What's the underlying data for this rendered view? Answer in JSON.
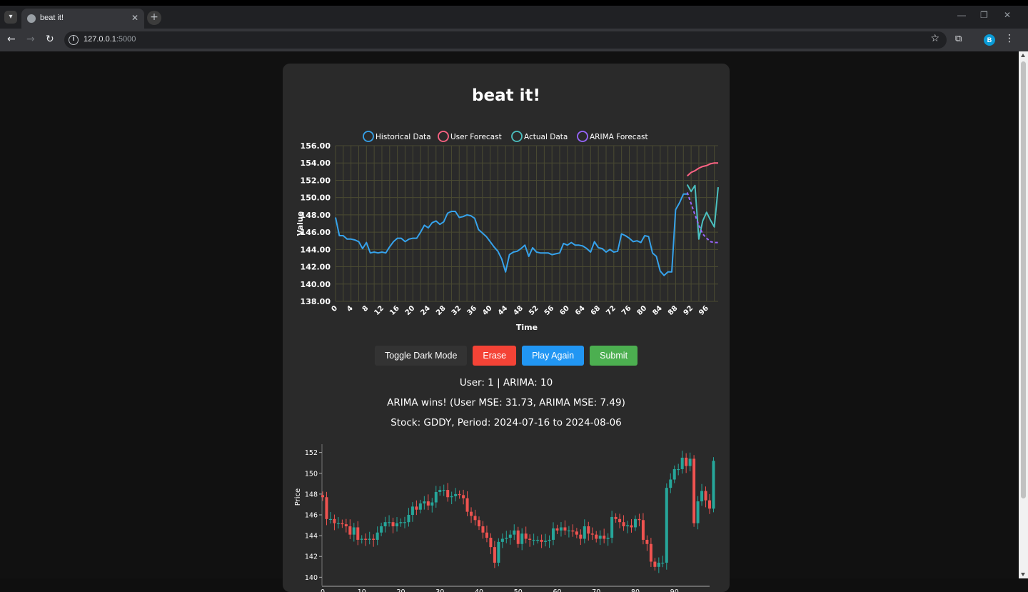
{
  "browser": {
    "tab_title": "beat it!",
    "url_host": "127.0.0.1",
    "url_port": ":5000",
    "avatar_letter": "B"
  },
  "page": {
    "title": "beat it!",
    "buttons": {
      "toggle_dark": "Toggle Dark Mode",
      "erase": "Erase",
      "play_again": "Play Again",
      "submit": "Submit"
    },
    "score_text": "User: 1 | ARIMA: 10",
    "result_text": "ARIMA wins! (User MSE: 31.73, ARIMA MSE: 7.49)",
    "stock_text": "Stock: GDDY, Period: 2024-07-16 to 2024-08-06"
  },
  "colors": {
    "historical": "#36a2eb",
    "user_forecast": "#ff6384",
    "actual": "#4bc0c0",
    "arima": "#9966ff",
    "candle_up": "#26a69a",
    "candle_down": "#ef5350",
    "erase_button": "#f44336",
    "play_button": "#2196f3",
    "submit_button": "#4caf50"
  },
  "chart_data": [
    {
      "type": "line",
      "title": "",
      "xlabel": "Time",
      "ylabel": "Value",
      "xlim": [
        0,
        99
      ],
      "ylim": [
        138,
        156
      ],
      "y_ticks": [
        "138.00",
        "140.00",
        "142.00",
        "144.00",
        "146.00",
        "148.00",
        "150.00",
        "152.00",
        "154.00",
        "156.00"
      ],
      "x_ticks": [
        "0",
        "4",
        "8",
        "12",
        "16",
        "20",
        "24",
        "28",
        "32",
        "36",
        "40",
        "44",
        "48",
        "52",
        "56",
        "60",
        "64",
        "68",
        "72",
        "76",
        "80",
        "84",
        "88",
        "92",
        "96"
      ],
      "grid": true,
      "legend_position": "top",
      "series": [
        {
          "name": "Historical Data",
          "x": [
            0,
            1,
            2,
            3,
            4,
            5,
            6,
            7,
            8,
            9,
            10,
            11,
            12,
            13,
            14,
            15,
            16,
            17,
            18,
            19,
            20,
            21,
            22,
            23,
            24,
            25,
            26,
            27,
            28,
            29,
            30,
            31,
            32,
            33,
            34,
            35,
            36,
            37,
            38,
            39,
            40,
            41,
            42,
            43,
            44,
            45,
            46,
            47,
            48,
            49,
            50,
            51,
            52,
            53,
            54,
            55,
            56,
            57,
            58,
            59,
            60,
            61,
            62,
            63,
            64,
            65,
            66,
            67,
            68,
            69,
            70,
            71,
            72,
            73,
            74,
            75,
            76,
            77,
            78,
            79,
            80,
            81,
            82,
            83,
            84,
            85,
            86,
            87,
            88,
            89,
            90,
            91
          ],
          "values": [
            147.7,
            145.6,
            145.6,
            145.2,
            145.2,
            145.1,
            144.9,
            144.1,
            144.8,
            143.6,
            143.7,
            143.6,
            143.7,
            143.6,
            144.3,
            144.9,
            145.3,
            145.3,
            144.9,
            145.2,
            145.3,
            145.3,
            146.0,
            146.8,
            146.5,
            147.1,
            147.3,
            146.9,
            147.2,
            148.2,
            148.4,
            148.4,
            147.7,
            147.8,
            148.0,
            147.9,
            147.6,
            146.3,
            145.9,
            145.5,
            144.9,
            144.3,
            143.8,
            142.9,
            141.4,
            143.4,
            143.7,
            143.8,
            144.1,
            144.5,
            143.2,
            144.2,
            143.7,
            143.6,
            143.6,
            143.6,
            143.4,
            143.5,
            143.6,
            144.7,
            144.5,
            144.8,
            144.5,
            144.5,
            144.4,
            144.1,
            143.7,
            144.9,
            144.2,
            144.1,
            143.7,
            144.0,
            143.7,
            143.8,
            145.8,
            145.6,
            145.3,
            144.9,
            145.0,
            144.8,
            145.6,
            145.5,
            143.6,
            143.2,
            141.5,
            141.0,
            141.4,
            141.4,
            148.6,
            149.4,
            150.4,
            150.4
          ],
          "dashed": false
        },
        {
          "name": "User Forecast",
          "x": [
            91,
            92,
            93,
            94,
            95,
            96,
            97,
            98,
            99
          ],
          "values": [
            152.5,
            152.9,
            153.1,
            153.4,
            153.6,
            153.7,
            153.9,
            154.0,
            154.0
          ],
          "dashed": false
        },
        {
          "name": "Actual Data",
          "x": [
            91,
            92,
            93,
            94,
            95,
            96,
            97,
            98,
            99
          ],
          "values": [
            151.5,
            150.7,
            151.4,
            145.2,
            147.3,
            148.3,
            147.4,
            146.6,
            151.2
          ],
          "dashed": false
        },
        {
          "name": "ARIMA Forecast",
          "x": [
            91,
            92,
            93,
            94,
            95,
            96,
            97,
            98,
            99
          ],
          "values": [
            150.6,
            149.3,
            148.0,
            146.8,
            145.8,
            145.3,
            144.9,
            144.8,
            144.8
          ],
          "dashed": true
        }
      ]
    },
    {
      "type": "candlestick",
      "title": "",
      "xlabel": "",
      "ylabel": "Price",
      "xlim": [
        0,
        99
      ],
      "ylim": [
        139.2,
        152.8
      ],
      "y_ticks": [
        "140",
        "142",
        "144",
        "146",
        "148",
        "150",
        "152"
      ],
      "x_ticks": [
        "0",
        "10",
        "20",
        "30",
        "40",
        "50",
        "60",
        "70",
        "80",
        "90"
      ],
      "grid": false,
      "close": [
        147.7,
        145.6,
        145.6,
        145.2,
        145.2,
        145.1,
        144.9,
        144.1,
        144.8,
        143.6,
        143.7,
        143.6,
        143.7,
        143.6,
        144.3,
        144.9,
        145.3,
        145.3,
        144.9,
        145.2,
        145.3,
        145.3,
        146.0,
        146.8,
        146.5,
        147.1,
        147.3,
        146.9,
        147.2,
        148.2,
        148.4,
        148.4,
        147.7,
        147.8,
        148.0,
        147.9,
        147.6,
        146.3,
        145.9,
        145.5,
        144.9,
        144.3,
        143.8,
        142.9,
        141.4,
        143.4,
        143.7,
        143.8,
        144.1,
        144.5,
        143.2,
        144.2,
        143.7,
        143.6,
        143.6,
        143.6,
        143.4,
        143.5,
        143.6,
        144.7,
        144.5,
        144.8,
        144.5,
        144.5,
        144.4,
        144.1,
        143.7,
        144.9,
        144.2,
        144.1,
        143.7,
        144.0,
        143.7,
        143.8,
        145.8,
        145.6,
        145.3,
        144.9,
        145.0,
        144.8,
        145.6,
        145.5,
        143.6,
        143.2,
        141.5,
        141.0,
        141.4,
        141.4,
        148.6,
        149.4,
        150.4,
        150.4,
        151.5,
        150.7,
        151.4,
        145.2,
        147.3,
        148.3,
        147.4,
        146.6,
        151.2
      ]
    }
  ]
}
